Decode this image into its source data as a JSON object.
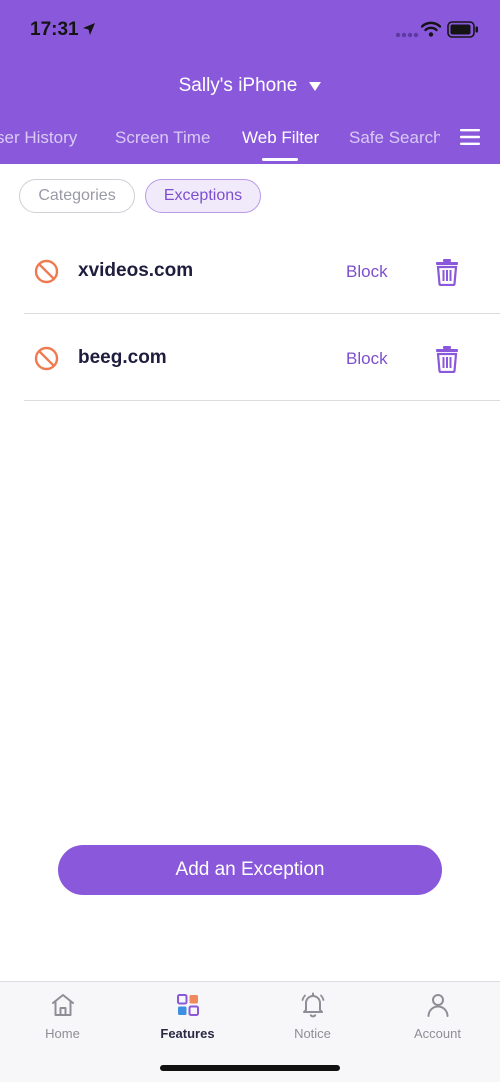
{
  "status_bar": {
    "time": "17:31"
  },
  "header": {
    "device_name": "Sally's iPhone",
    "tabs": [
      {
        "label": "ser History"
      },
      {
        "label": "Screen Time"
      },
      {
        "label": "Web Filter"
      },
      {
        "label": "Safe Search"
      }
    ],
    "active_tab": "Web Filter"
  },
  "filters": {
    "chips": [
      {
        "label": "Categories"
      },
      {
        "label": "Exceptions"
      }
    ],
    "active_chip": "Exceptions"
  },
  "exceptions": [
    {
      "domain": "xvideos.com",
      "action": "Block"
    },
    {
      "domain": "beeg.com",
      "action": "Block"
    }
  ],
  "add_button_label": "Add an Exception",
  "bottom_nav": {
    "items": [
      {
        "label": "Home",
        "icon": "home-icon"
      },
      {
        "label": "Features",
        "icon": "features-icon"
      },
      {
        "label": "Notice",
        "icon": "bell-icon"
      },
      {
        "label": "Account",
        "icon": "person-icon"
      }
    ],
    "active": "Features"
  },
  "colors": {
    "brand": "#8a58db",
    "accent_text": "#7d4fce",
    "block_icon": "#ef7a50"
  }
}
